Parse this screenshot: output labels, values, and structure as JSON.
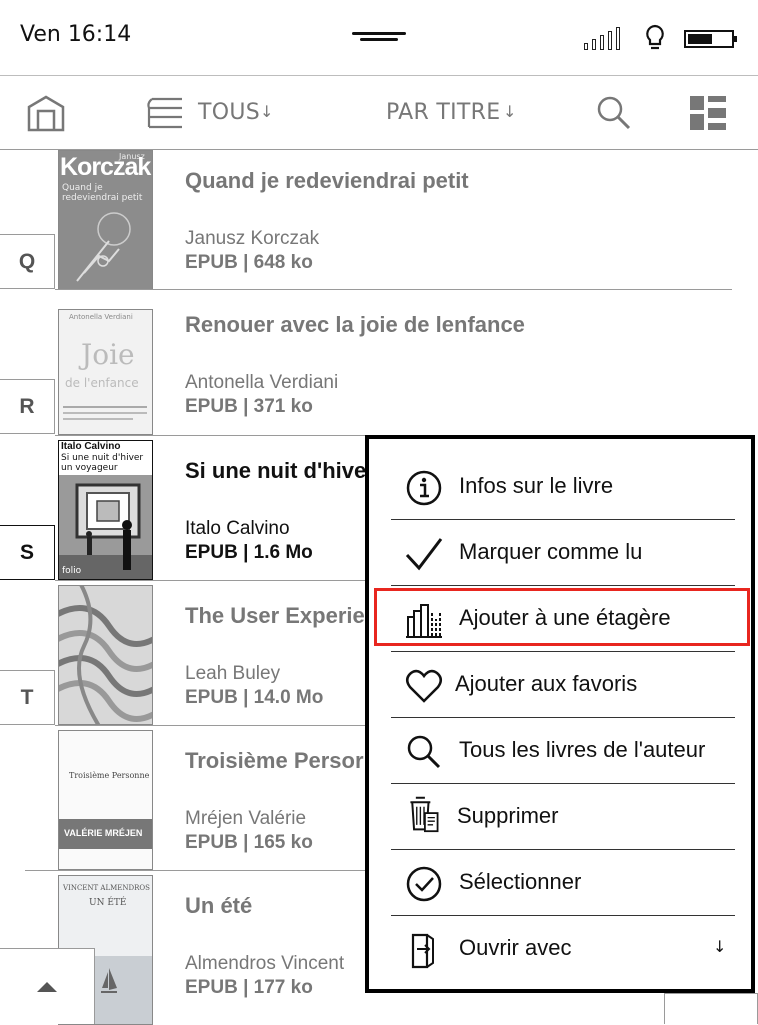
{
  "status_bar": {
    "time": "Ven 16:14"
  },
  "toolbar": {
    "filter_label": "TOUS",
    "sort_label": "PAR TITRE"
  },
  "books": [
    {
      "letter": "Q",
      "title": "Quand je redeviendrai petit",
      "author": "Janusz Korczak",
      "meta": "EPUB | 648 ko",
      "cover": {
        "author_text": "Korczak",
        "top_text": "Janusz",
        "title_text": "Quand je redeviendrai petit"
      }
    },
    {
      "letter": "R",
      "title": "Renouer avec la joie de lenfance",
      "author": "Antonella Verdiani",
      "meta": "EPUB | 371 ko",
      "cover": {
        "author_text": "Antonella Verdiani",
        "title_text": "Joie",
        "subtitle_text": "de l'enfance"
      }
    },
    {
      "letter": "S",
      "title": "Si une nuit d'hiver",
      "author": "Italo Calvino",
      "meta": "EPUB | 1.6 Mo",
      "cover": {
        "author_text": "Italo Calvino",
        "title_text": "Si une nuit d'hiver un voyageur",
        "publisher": "folio"
      }
    },
    {
      "letter": "T",
      "title": "The User Experie",
      "author": "Leah Buley",
      "meta": "EPUB | 14.0 Mo",
      "cover": {}
    },
    {
      "letter": "",
      "title": "Troisième Persor",
      "author": "Mréjen Valérie",
      "meta": "EPUB | 165 ko",
      "cover": {
        "title_text": "Troisième Personne",
        "author_text": "VALÉRIE MRÉJEN"
      }
    },
    {
      "letter": "",
      "title": "Un été",
      "author": "Almendros Vincent",
      "meta": "EPUB | 177 ko",
      "cover": {
        "author_text": "VINCENT ALMENDROS",
        "title_text": "UN ÉTÉ"
      }
    }
  ],
  "context_menu": {
    "items": [
      {
        "label": "Infos sur le livre",
        "icon": "info-icon"
      },
      {
        "label": "Marquer comme lu",
        "icon": "checkmark-icon"
      },
      {
        "label": "Ajouter à une étagère",
        "icon": "bookshelf-icon",
        "highlighted": true
      },
      {
        "label": "Ajouter aux favoris",
        "icon": "heart-icon"
      },
      {
        "label": "Tous les livres de l'auteur",
        "icon": "search-icon"
      },
      {
        "label": "Supprimer",
        "icon": "trash-icon"
      },
      {
        "label": "Sélectionner",
        "icon": "circle-check-icon"
      },
      {
        "label": "Ouvrir avec",
        "icon": "open-with-icon"
      }
    ]
  },
  "colors": {
    "highlight": "#e8261f",
    "text_dim": "#777777",
    "text_active": "#111111"
  }
}
